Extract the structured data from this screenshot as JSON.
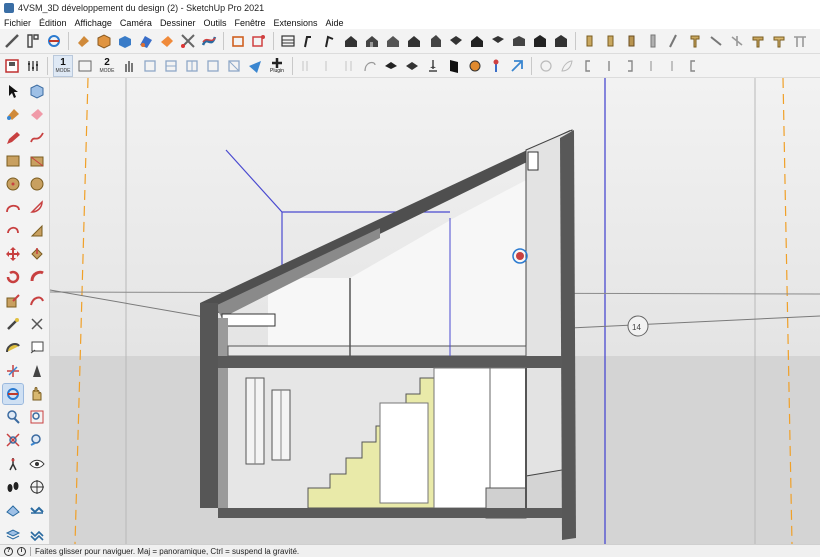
{
  "window": {
    "title": "4VSM_3D développement du design (2) - SketchUp Pro 2021"
  },
  "menu": [
    "Fichier",
    "Édition",
    "Affichage",
    "Caméra",
    "Dessiner",
    "Outils",
    "Fenêtre",
    "Extensions",
    "Aide"
  ],
  "toolbar2": {
    "mode1_number": "1",
    "mode1_label": "MODE",
    "mode2_number": "2",
    "mode2_label": "MODE",
    "plugin_label": "Plugin"
  },
  "viewport": {
    "section_marker_label": "14"
  },
  "status": {
    "message": "Faites glisser pour naviguer. Maj = panoramique, Ctrl =  suspend la gravité."
  },
  "colors": {
    "sky": "#ececec",
    "ground": "#d7d7d7",
    "section_fill": "#5f5f5f",
    "stair_fill": "#e9eaa9",
    "guide_orange": "#f0a028",
    "guide_blue": "#4a4ad0",
    "active_tool": "#cfe0f3"
  },
  "icons": {
    "toolbar1": [
      "line-tool-icon",
      "tape-measure-icon",
      "orbit-icon",
      "paint-bucket-icon",
      "box-icon",
      "push-pull-icon",
      "paint-icon",
      "eraser-icon",
      "scissors-icon",
      "sandbox-icon",
      "section-plane-icon",
      "section-display-icon",
      "component-icon",
      "model-view-icon"
    ],
    "toolbar2": [
      "save-icon",
      "adjust-icon",
      "mode-icon",
      "rectangle-icon",
      "hand-icon",
      "window-view-icon",
      "plugin-icon"
    ],
    "left": [
      "select-icon",
      "component-icon",
      "paint-bucket-icon",
      "eraser-icon",
      "pencil-icon",
      "freehand-icon",
      "rectangle-icon",
      "rotated-rectangle-icon",
      "circle-icon",
      "polygon-icon",
      "arc-icon",
      "pie-icon",
      "arc-3pt-icon",
      "arc-pie-icon",
      "move-icon",
      "push-pull-icon",
      "rotate-icon",
      "follow-me-icon",
      "scale-icon",
      "offset-icon",
      "tape-measure-icon",
      "dimension-icon",
      "protractor-icon",
      "text-icon",
      "axes-icon",
      "3d-text-icon",
      "orbit-icon",
      "pan-icon",
      "zoom-icon",
      "zoom-window-icon",
      "zoom-extents-icon",
      "previous-view-icon",
      "position-camera-icon",
      "look-around-icon",
      "walk-icon",
      "section-plane-icon",
      "sandbox-icon",
      "stamp-icon",
      "layers-icon",
      "smoove-icon"
    ]
  }
}
